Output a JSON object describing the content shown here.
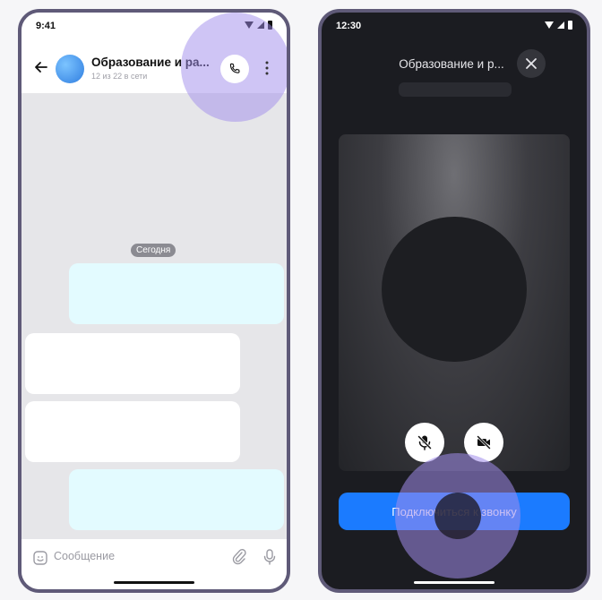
{
  "left_phone": {
    "status_time": "9:41",
    "chat_title": "Образование и ра...",
    "chat_subtitle": "12 из 22 в сети",
    "date_chip": "Сегодня",
    "composer_placeholder": "Сообщение",
    "icons": [
      "back-arrow-icon",
      "phone-icon",
      "more-vertical-icon",
      "emoji-icon",
      "paperclip-icon",
      "microphone-icon"
    ]
  },
  "right_phone": {
    "status_time": "12:30",
    "call_title": "Образование и р...",
    "join_button_label": "Подключиться к звонку",
    "icons": [
      "close-icon",
      "microphone-off-icon",
      "camera-off-icon"
    ]
  },
  "colors": {
    "accent_blue": "#1b7bff",
    "highlight_purple": "#a08ceb",
    "bubble_outgoing": "#e3fbff",
    "call_background": "#1b1c21",
    "phone_frame": "#5f5a78"
  }
}
